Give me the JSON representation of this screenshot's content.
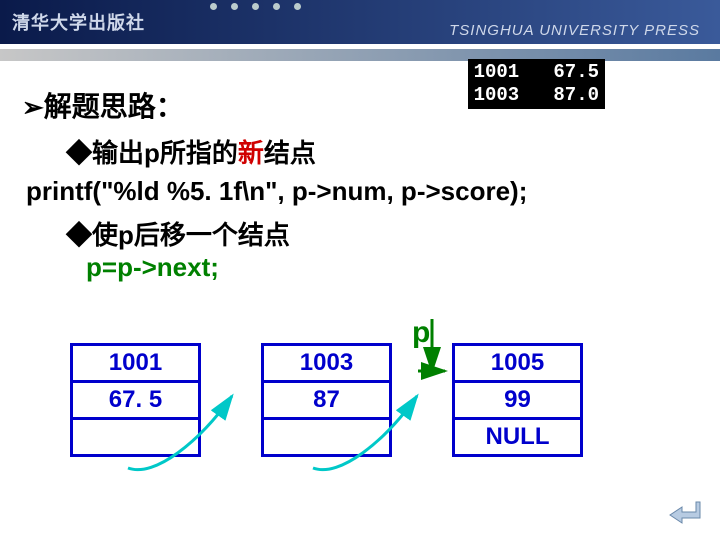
{
  "header": {
    "brand": "清华大学出版社",
    "press": "TSINGHUA UNIVERSITY PRESS"
  },
  "console": {
    "line1": "1001   67.5",
    "line2": "1003   87.0"
  },
  "heading": {
    "bullet": "➢",
    "text": "解题思路："
  },
  "sub1": {
    "bullet": "◆",
    "prefix": "输出p所指的",
    "highlight": "新",
    "suffix": "结点"
  },
  "code_printf": "printf(\"%ld %5. 1f\\n\", p->num, p->score);",
  "sub2": {
    "bullet": "◆",
    "text": "使p后移一个结点"
  },
  "code_pnext": "p=p->next;",
  "pointer_label": "p",
  "nodes": [
    {
      "num": "1001",
      "score": "67. 5",
      "next": ""
    },
    {
      "num": "1003",
      "score": "87",
      "next": ""
    },
    {
      "num": "1005",
      "score": "99",
      "next": "NULL"
    }
  ]
}
